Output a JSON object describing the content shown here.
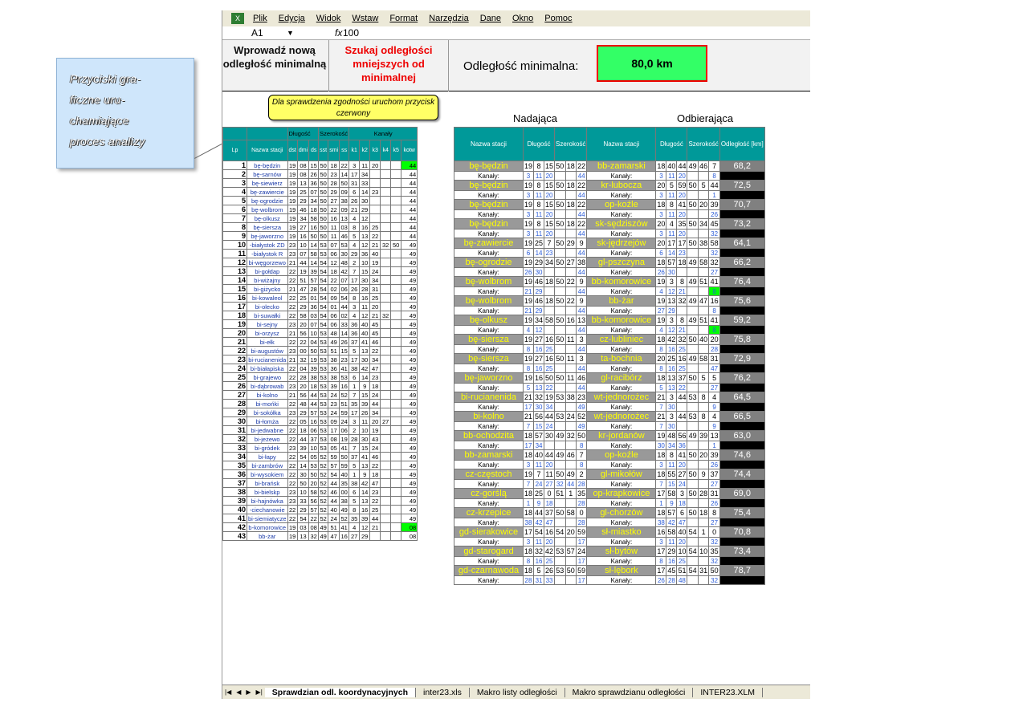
{
  "callout": {
    "line1": "Przyciski gra-",
    "line2": "ficzne uru-",
    "line3": "chamiające",
    "line4": "proces analizy"
  },
  "menu": [
    "Plik",
    "Edycja",
    "Widok",
    "Wstaw",
    "Format",
    "Narzędzia",
    "Dane",
    "Okno",
    "Pomoc"
  ],
  "formula": {
    "cell": "A1",
    "fx": "fx",
    "value": "100"
  },
  "buttons": {
    "new_min": "Wprowadź nową odległość minimalną",
    "search_less": "Szukaj odległości mniejszych od minimalnej"
  },
  "min": {
    "label": "Odległość minimalna:",
    "value": "80,0 km"
  },
  "hint": "Dla sprawdzenia zgodności uruchom przycisk czerwony",
  "sections": {
    "sending": "Nadająca",
    "receiving": "Odbierająca"
  },
  "left_headers": {
    "dlugosc": "Długość",
    "szerokosc": "Szerokość",
    "kanaly": "Kanały",
    "lp": "Lp",
    "nazwa": "Nazwa stacji",
    "cols": [
      "dst",
      "dmi",
      "ds",
      "sst",
      "smi",
      "ss",
      "k1",
      "k2",
      "k3",
      "k4",
      "k5",
      "kotw"
    ]
  },
  "left_rows": [
    [
      "1",
      "bę-będzin",
      "19",
      "08",
      "15",
      "50",
      "18",
      "22",
      "3",
      "11",
      "20",
      "",
      "",
      "44"
    ],
    [
      "2",
      "bę-sarnów",
      "19",
      "08",
      "26",
      "50",
      "23",
      "14",
      "17",
      "34",
      "",
      "",
      "",
      "44"
    ],
    [
      "3",
      "bę-siewierz",
      "19",
      "13",
      "36",
      "50",
      "28",
      "50",
      "31",
      "33",
      "",
      "",
      "",
      "44"
    ],
    [
      "4",
      "bę-zawiercie",
      "19",
      "25",
      "07",
      "50",
      "29",
      "09",
      "6",
      "14",
      "23",
      "",
      "",
      "44"
    ],
    [
      "5",
      "bę-ogrodzie",
      "19",
      "29",
      "34",
      "50",
      "27",
      "38",
      "26",
      "30",
      "",
      "",
      "",
      "44"
    ],
    [
      "6",
      "bę-wolbrom",
      "19",
      "46",
      "18",
      "50",
      "22",
      "09",
      "21",
      "29",
      "",
      "",
      "",
      "44"
    ],
    [
      "7",
      "bę-olkusz",
      "19",
      "34",
      "58",
      "50",
      "16",
      "13",
      "4",
      "12",
      "",
      "",
      "",
      "44"
    ],
    [
      "8",
      "bę-siersza",
      "19",
      "27",
      "16",
      "50",
      "11",
      "03",
      "8",
      "16",
      "25",
      "",
      "",
      "44"
    ],
    [
      "9",
      "bę-jaworzno",
      "19",
      "16",
      "50",
      "50",
      "11",
      "46",
      "5",
      "13",
      "22",
      "",
      "",
      "44"
    ],
    [
      "10",
      "-białystok ZD",
      "23",
      "10",
      "14",
      "53",
      "07",
      "53",
      "4",
      "12",
      "21",
      "32",
      "50",
      "49"
    ],
    [
      "11",
      "-białystok R",
      "23",
      "07",
      "58",
      "53",
      "06",
      "30",
      "29",
      "36",
      "40",
      "",
      "",
      "49"
    ],
    [
      "12",
      "bi-węgorzewo",
      "21",
      "44",
      "14",
      "54",
      "12",
      "48",
      "2",
      "10",
      "19",
      "",
      "",
      "49"
    ],
    [
      "13",
      "bi-gołdap",
      "22",
      "19",
      "39",
      "54",
      "18",
      "42",
      "7",
      "15",
      "24",
      "",
      "",
      "49"
    ],
    [
      "14",
      "bi-wiżajny",
      "22",
      "51",
      "57",
      "54",
      "22",
      "07",
      "17",
      "30",
      "34",
      "",
      "",
      "49"
    ],
    [
      "15",
      "bi-giżycko",
      "21",
      "47",
      "28",
      "54",
      "02",
      "06",
      "26",
      "28",
      "31",
      "",
      "",
      "49"
    ],
    [
      "16",
      "bi-kowaleol",
      "22",
      "25",
      "01",
      "54",
      "09",
      "54",
      "8",
      "16",
      "25",
      "",
      "",
      "49"
    ],
    [
      "17",
      "bi-olecko",
      "22",
      "29",
      "36",
      "54",
      "01",
      "44",
      "3",
      "11",
      "20",
      "",
      "",
      "49"
    ],
    [
      "18",
      "bi-suwałki",
      "22",
      "58",
      "03",
      "54",
      "06",
      "02",
      "4",
      "12",
      "21",
      "32",
      "",
      "49"
    ],
    [
      "19",
      "bi-sejny",
      "23",
      "20",
      "07",
      "54",
      "06",
      "33",
      "36",
      "40",
      "45",
      "",
      "",
      "49"
    ],
    [
      "20",
      "bi-orzysz",
      "21",
      "56",
      "10",
      "53",
      "48",
      "14",
      "36",
      "40",
      "45",
      "",
      "",
      "49"
    ],
    [
      "21",
      "bi-ełk",
      "22",
      "22",
      "04",
      "53",
      "49",
      "26",
      "37",
      "41",
      "46",
      "",
      "",
      "49"
    ],
    [
      "22",
      "bi-augustów",
      "23",
      "00",
      "50",
      "53",
      "51",
      "15",
      "5",
      "13",
      "22",
      "",
      "",
      "49"
    ],
    [
      "23",
      "bi-rucianenida",
      "21",
      "32",
      "19",
      "53",
      "38",
      "23",
      "17",
      "30",
      "34",
      "",
      "",
      "49"
    ],
    [
      "24",
      "bi-białapiska",
      "22",
      "04",
      "39",
      "53",
      "36",
      "41",
      "38",
      "42",
      "47",
      "",
      "",
      "49"
    ],
    [
      "25",
      "bi-grajewo",
      "22",
      "28",
      "38",
      "53",
      "38",
      "53",
      "6",
      "14",
      "23",
      "",
      "",
      "49"
    ],
    [
      "26",
      "bi-dąbrowab",
      "23",
      "20",
      "18",
      "53",
      "39",
      "16",
      "1",
      "9",
      "18",
      "",
      "",
      "49"
    ],
    [
      "27",
      "bi-kolno",
      "21",
      "56",
      "44",
      "53",
      "24",
      "52",
      "7",
      "15",
      "24",
      "",
      "",
      "49"
    ],
    [
      "28",
      "bi-mońki",
      "22",
      "48",
      "44",
      "53",
      "23",
      "51",
      "35",
      "39",
      "44",
      "",
      "",
      "49"
    ],
    [
      "29",
      "bi-sokółka",
      "23",
      "29",
      "57",
      "53",
      "24",
      "59",
      "17",
      "26",
      "34",
      "",
      "",
      "49"
    ],
    [
      "30",
      "bi-łomża",
      "22",
      "05",
      "16",
      "53",
      "09",
      "24",
      "3",
      "11",
      "20",
      "27",
      "",
      "49"
    ],
    [
      "31",
      "bi-jedwabne",
      "22",
      "18",
      "06",
      "53",
      "17",
      "06",
      "2",
      "10",
      "19",
      "",
      "",
      "49"
    ],
    [
      "32",
      "bi-jeżewo",
      "22",
      "44",
      "37",
      "53",
      "08",
      "19",
      "28",
      "30",
      "43",
      "",
      "",
      "49"
    ],
    [
      "33",
      "bi-gródek",
      "23",
      "39",
      "10",
      "53",
      "05",
      "41",
      "7",
      "15",
      "24",
      "",
      "",
      "49"
    ],
    [
      "34",
      "bi-łapy",
      "22",
      "54",
      "05",
      "52",
      "59",
      "50",
      "37",
      "41",
      "46",
      "",
      "",
      "49"
    ],
    [
      "35",
      "bi-zambrów",
      "22",
      "14",
      "53",
      "52",
      "57",
      "59",
      "5",
      "13",
      "22",
      "",
      "",
      "49"
    ],
    [
      "36",
      "bi-wysokiem",
      "22",
      "30",
      "50",
      "52",
      "54",
      "40",
      "1",
      "9",
      "18",
      "",
      "",
      "49"
    ],
    [
      "37",
      "bi-brańsk",
      "22",
      "50",
      "20",
      "52",
      "44",
      "35",
      "38",
      "42",
      "47",
      "",
      "",
      "49"
    ],
    [
      "38",
      "bi-bielskp",
      "23",
      "10",
      "58",
      "52",
      "46",
      "00",
      "6",
      "14",
      "23",
      "",
      "",
      "49"
    ],
    [
      "39",
      "bi-hajnówka",
      "23",
      "33",
      "56",
      "52",
      "44",
      "38",
      "5",
      "13",
      "22",
      "",
      "",
      "49"
    ],
    [
      "40",
      "-ciechanowie",
      "22",
      "29",
      "57",
      "52",
      "40",
      "49",
      "8",
      "16",
      "25",
      "",
      "",
      "49"
    ],
    [
      "41",
      "bi-siemiatycze",
      "22",
      "54",
      "22",
      "52",
      "24",
      "52",
      "35",
      "39",
      "44",
      "",
      "",
      "49"
    ],
    [
      "42",
      "b-komorowice",
      "19",
      "03",
      "08",
      "49",
      "51",
      "41",
      "4",
      "12",
      "21",
      "",
      "",
      "08"
    ],
    [
      "43",
      "bb-żar",
      "19",
      "13",
      "32",
      "49",
      "47",
      "16",
      "27",
      "29",
      "",
      "",
      "",
      "08"
    ]
  ],
  "right_headers": {
    "nazwa": "Nazwa stacji",
    "dlugosc": "Długość",
    "szerokosc": "Szerokość",
    "distance": "Odległość [km]",
    "kanaly": "Kanały:"
  },
  "pairs": [
    {
      "s": [
        "bę-będzin",
        "19",
        "8",
        "15",
        "50",
        "18",
        "22"
      ],
      "sk": [
        "3",
        "11",
        "20",
        "",
        "",
        "44"
      ],
      "r": [
        "bb-zamarski",
        "18",
        "40",
        "44",
        "49",
        "46",
        "7"
      ],
      "rk": [
        "3",
        "11",
        "20",
        "",
        "",
        "8"
      ],
      "d": "68,2"
    },
    {
      "s": [
        "bę-będzin",
        "19",
        "8",
        "15",
        "50",
        "18",
        "22"
      ],
      "sk": [
        "3",
        "11",
        "20",
        "",
        "",
        "44"
      ],
      "r": [
        "kr-lubocza",
        "20",
        "5",
        "59",
        "50",
        "5",
        "44"
      ],
      "rk": [
        "3",
        "11",
        "20",
        "",
        "",
        "1"
      ],
      "d": "72,5"
    },
    {
      "s": [
        "bę-będzin",
        "19",
        "8",
        "15",
        "50",
        "18",
        "22"
      ],
      "sk": [
        "3",
        "11",
        "20",
        "",
        "",
        "44"
      ],
      "r": [
        "op-koźle",
        "18",
        "8",
        "41",
        "50",
        "20",
        "39"
      ],
      "rk": [
        "3",
        "11",
        "20",
        "",
        "",
        "26"
      ],
      "d": "70,7"
    },
    {
      "s": [
        "bę-będzin",
        "19",
        "8",
        "15",
        "50",
        "18",
        "22"
      ],
      "sk": [
        "3",
        "11",
        "20",
        "",
        "",
        "44"
      ],
      "r": [
        "sk-sędziszów",
        "20",
        "4",
        "35",
        "50",
        "34",
        "45"
      ],
      "rk": [
        "3",
        "11",
        "20",
        "",
        "",
        "32"
      ],
      "d": "73,2"
    },
    {
      "s": [
        "bę-zawiercie",
        "19",
        "25",
        "7",
        "50",
        "29",
        "9"
      ],
      "sk": [
        "6",
        "14",
        "23",
        "",
        "",
        "44"
      ],
      "r": [
        "sk-jędrzejów",
        "20",
        "17",
        "17",
        "50",
        "38",
        "58"
      ],
      "rk": [
        "6",
        "14",
        "23",
        "",
        "",
        "32"
      ],
      "d": "64,1"
    },
    {
      "s": [
        "bę-ogrodzie",
        "19",
        "29",
        "34",
        "50",
        "27",
        "38"
      ],
      "sk": [
        "26",
        "30",
        "",
        "",
        "",
        "44"
      ],
      "r": [
        "gl-pszczyna",
        "18",
        "57",
        "18",
        "49",
        "58",
        "32"
      ],
      "rk": [
        "26",
        "30",
        "",
        "",
        "",
        "27"
      ],
      "d": "66,2"
    },
    {
      "s": [
        "bę-wolbrom",
        "19",
        "46",
        "18",
        "50",
        "22",
        "9"
      ],
      "sk": [
        "21",
        "29",
        "",
        "",
        "",
        "44"
      ],
      "r": [
        "bb-komorowice",
        "19",
        "3",
        "8",
        "49",
        "51",
        "41"
      ],
      "rk": [
        "4",
        "12",
        "21",
        "",
        "",
        "8"
      ],
      "d": "76,4"
    },
    {
      "s": [
        "bę-wolbrom",
        "19",
        "46",
        "18",
        "50",
        "22",
        "9"
      ],
      "sk": [
        "21",
        "29",
        "",
        "",
        "",
        "44"
      ],
      "r": [
        "bb-żar",
        "19",
        "13",
        "32",
        "49",
        "47",
        "16"
      ],
      "rk": [
        "27",
        "29",
        "",
        "",
        "",
        "8"
      ],
      "d": "75,6"
    },
    {
      "s": [
        "bę-olkusz",
        "19",
        "34",
        "58",
        "50",
        "16",
        "13"
      ],
      "sk": [
        "4",
        "12",
        "",
        "",
        "",
        "44"
      ],
      "r": [
        "bb-komorowice",
        "19",
        "3",
        "8",
        "49",
        "51",
        "41"
      ],
      "rk": [
        "4",
        "12",
        "21",
        "",
        "",
        "8"
      ],
      "d": "59,2"
    },
    {
      "s": [
        "bę-siersza",
        "19",
        "27",
        "16",
        "50",
        "11",
        "3"
      ],
      "sk": [
        "8",
        "16",
        "25",
        "",
        "",
        "44"
      ],
      "r": [
        "cz-lubliniec",
        "18",
        "42",
        "32",
        "50",
        "40",
        "20"
      ],
      "rk": [
        "8",
        "16",
        "25",
        "",
        "",
        "28"
      ],
      "d": "75,8"
    },
    {
      "s": [
        "bę-siersza",
        "19",
        "27",
        "16",
        "50",
        "11",
        "3"
      ],
      "sk": [
        "8",
        "16",
        "25",
        "",
        "",
        "44"
      ],
      "r": [
        "ta-bochnia",
        "20",
        "25",
        "16",
        "49",
        "58",
        "31"
      ],
      "rk": [
        "8",
        "16",
        "25",
        "",
        "",
        "47"
      ],
      "d": "72,9"
    },
    {
      "s": [
        "bę-jaworzno",
        "19",
        "16",
        "50",
        "50",
        "11",
        "46"
      ],
      "sk": [
        "5",
        "13",
        "22",
        "",
        "",
        "44"
      ],
      "r": [
        "gl-racibórz",
        "18",
        "13",
        "37",
        "50",
        "5",
        "5"
      ],
      "rk": [
        "5",
        "13",
        "22",
        "",
        "",
        "27"
      ],
      "d": "76,2"
    },
    {
      "s": [
        "bi-rucianenida",
        "21",
        "32",
        "19",
        "53",
        "38",
        "23"
      ],
      "sk": [
        "17",
        "30",
        "34",
        "",
        "",
        "49"
      ],
      "r": [
        "wt-jednorożec",
        "21",
        "3",
        "44",
        "53",
        "8",
        "4"
      ],
      "rk": [
        "7",
        "30",
        "",
        "",
        "",
        "9"
      ],
      "d": "64,5"
    },
    {
      "s": [
        "bi-kolno",
        "21",
        "56",
        "44",
        "53",
        "24",
        "52"
      ],
      "sk": [
        "7",
        "15",
        "24",
        "",
        "",
        "49"
      ],
      "r": [
        "wt-jednorożec",
        "21",
        "3",
        "44",
        "53",
        "8",
        "4"
      ],
      "rk": [
        "7",
        "30",
        "",
        "",
        "",
        "9"
      ],
      "d": "66,5"
    },
    {
      "s": [
        "bb-ochodzita",
        "18",
        "57",
        "30",
        "49",
        "32",
        "50"
      ],
      "sk": [
        "17",
        "34",
        "",
        "",
        "",
        "8"
      ],
      "r": [
        "kr-jordanów",
        "19",
        "48",
        "56",
        "49",
        "39",
        "13"
      ],
      "rk": [
        "30",
        "34",
        "36",
        "",
        "",
        "1"
      ],
      "d": "63,0"
    },
    {
      "s": [
        "bb-zamarski",
        "18",
        "40",
        "44",
        "49",
        "46",
        "7"
      ],
      "sk": [
        "3",
        "11",
        "20",
        "",
        "",
        "8"
      ],
      "r": [
        "op-koźle",
        "18",
        "8",
        "41",
        "50",
        "20",
        "39"
      ],
      "rk": [
        "3",
        "11",
        "20",
        "",
        "",
        "26"
      ],
      "d": "74,6"
    },
    {
      "s": [
        "cz-częstoch",
        "19",
        "7",
        "11",
        "50",
        "49",
        "2"
      ],
      "sk": [
        "7",
        "24",
        "27",
        "32",
        "44",
        "28"
      ],
      "r": [
        "gl-mikołów",
        "18",
        "55",
        "27",
        "50",
        "9",
        "37"
      ],
      "rk": [
        "7",
        "15",
        "24",
        "",
        "",
        "27"
      ],
      "d": "74,4"
    },
    {
      "s": [
        "cz-gorślą",
        "18",
        "25",
        "0",
        "51",
        "1",
        "35"
      ],
      "sk": [
        "1",
        "9",
        "18",
        "",
        "",
        "28"
      ],
      "r": [
        "op-krapkowice",
        "17",
        "58",
        "3",
        "50",
        "28",
        "31"
      ],
      "rk": [
        "1",
        "9",
        "18",
        "",
        "",
        "26"
      ],
      "d": "69,0"
    },
    {
      "s": [
        "cz-krzepice",
        "18",
        "44",
        "37",
        "50",
        "58",
        "0"
      ],
      "sk": [
        "38",
        "42",
        "47",
        "",
        "",
        "28"
      ],
      "r": [
        "gl-chorzów",
        "18",
        "57",
        "6",
        "50",
        "18",
        "8"
      ],
      "rk": [
        "38",
        "42",
        "47",
        "",
        "",
        "27"
      ],
      "d": "75,4"
    },
    {
      "s": [
        "gd-sierakowice",
        "17",
        "54",
        "16",
        "54",
        "20",
        "59"
      ],
      "sk": [
        "3",
        "11",
        "20",
        "",
        "",
        "17"
      ],
      "r": [
        "sł-miastko",
        "16",
        "58",
        "40",
        "54",
        "1",
        "0"
      ],
      "rk": [
        "3",
        "11",
        "20",
        "",
        "",
        "32"
      ],
      "d": "70,8"
    },
    {
      "s": [
        "gd-starogard",
        "18",
        "32",
        "42",
        "53",
        "57",
        "24"
      ],
      "sk": [
        "8",
        "16",
        "25",
        "",
        "",
        "17"
      ],
      "r": [
        "sł-bytów",
        "17",
        "29",
        "10",
        "54",
        "10",
        "35"
      ],
      "rk": [
        "8",
        "16",
        "25",
        "",
        "",
        "32"
      ],
      "d": "73,4"
    },
    {
      "s": [
        "gd-czarnawoda",
        "18",
        "5",
        "26",
        "53",
        "50",
        "59"
      ],
      "sk": [
        "28",
        "31",
        "33",
        "",
        "",
        "17"
      ],
      "r": [
        "sł-lębork",
        "17",
        "45",
        "51",
        "54",
        "31",
        "50"
      ],
      "rk": [
        "26",
        "28",
        "48",
        "",
        "",
        "32"
      ],
      "d": "78,7"
    }
  ],
  "tabs": [
    "Sprawdzian odl. koordynacyjnych",
    "inter23.xls",
    "Makro listy odległości",
    "Makro sprawdzianu odległości",
    "INTER23.XLM"
  ]
}
